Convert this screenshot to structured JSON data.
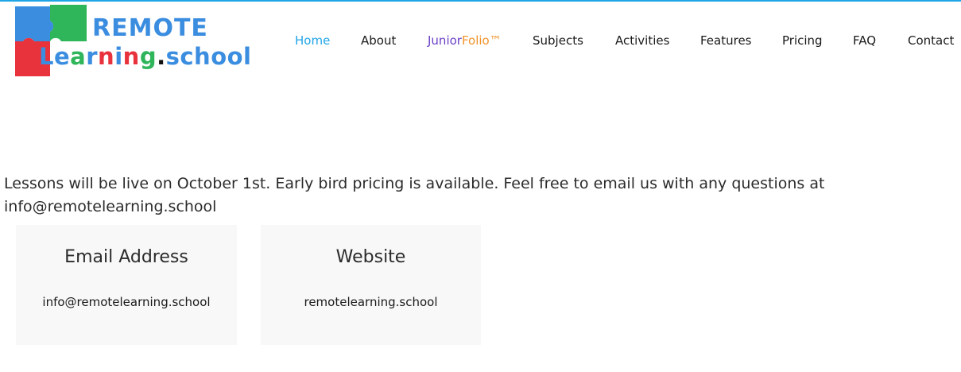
{
  "logo": {
    "line1": "REMOTE",
    "line2_parts": [
      {
        "text": "L",
        "color": "#3b8de0"
      },
      {
        "text": "e",
        "color": "#3b8de0"
      },
      {
        "text": "a",
        "color": "#2fb55a"
      },
      {
        "text": "r",
        "color": "#3b8de0"
      },
      {
        "text": "n",
        "color": "#e8323c"
      },
      {
        "text": "i",
        "color": "#3b8de0"
      },
      {
        "text": "n",
        "color": "#e8323c"
      },
      {
        "text": "g",
        "color": "#2fb55a"
      },
      {
        "text": ".",
        "color": "#111111"
      },
      {
        "text": "school",
        "color": "#3b8de0"
      }
    ],
    "puzzle_colors": {
      "blue": "#3b8de0",
      "green": "#2fb55a",
      "red": "#e8323c"
    }
  },
  "nav": {
    "items": [
      {
        "label": "Home",
        "active": true
      },
      {
        "label": "About"
      },
      {
        "label_part1": "Junior",
        "label_part2": "Folio™"
      },
      {
        "label": "Subjects"
      },
      {
        "label": "Activities"
      },
      {
        "label": "Features"
      },
      {
        "label": "Pricing"
      },
      {
        "label": "FAQ"
      },
      {
        "label": "Contact"
      }
    ]
  },
  "main": {
    "announcement": "Lessons will be live on October 1st. Early bird pricing is available. Feel free to email us with any questions at info@remotelearning.school",
    "cards": [
      {
        "title": "Email Address",
        "value": "info@remotelearning.school"
      },
      {
        "title": "Website",
        "value": "remotelearning.school"
      }
    ]
  },
  "colors": {
    "accent": "#1fa5e6",
    "junior": "#6a3fc6",
    "folio": "#f0932a",
    "card_bg": "#f8f8f8"
  }
}
